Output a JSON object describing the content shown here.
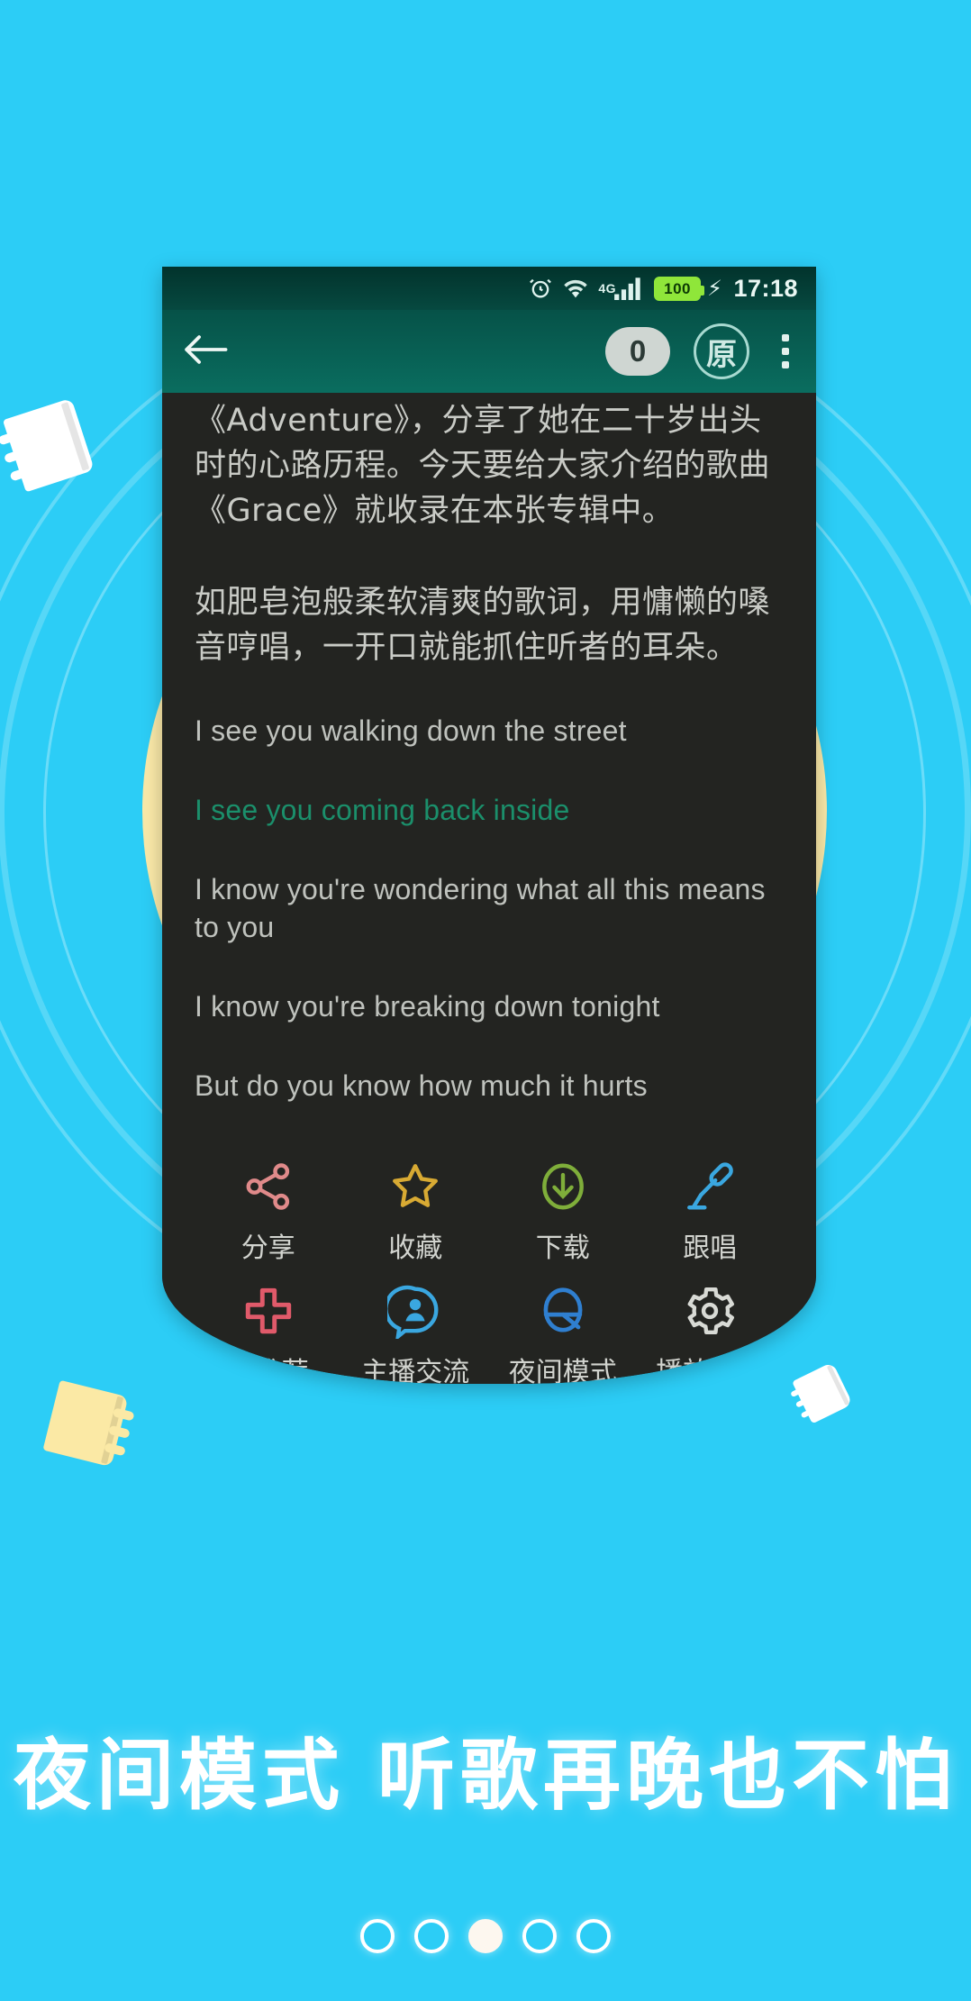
{
  "theme": {
    "background": "#2ccdf6",
    "ring_color": "#ffffff",
    "disc_color": "#fae9a8",
    "header_green": "#0a6d5f",
    "screen_dark": "#232421",
    "active_lyric": "#1b8f6b"
  },
  "phone": {
    "status_bar": {
      "alarm_icon": "alarm-clock-icon",
      "wifi_icon": "wifi-icon",
      "network_label": "4G",
      "signal_icon": "signal-bars-icon",
      "battery_level": "100",
      "charging_icon": "lightning-bolt-icon",
      "time": "17:18"
    },
    "toolbar": {
      "back_icon": "back-arrow-icon",
      "count_badge": "0",
      "original_label": "原",
      "overflow_icon": "kebab-menu-icon"
    },
    "article": {
      "paragraphs": [
        "《Adventure》，分享了她在二十岁出头时的心路历程。今天要给大家介绍的歌曲《Grace》就收录在本张专辑中。",
        "如肥皂泡般柔软清爽的歌词，用慵懒的嗓音哼唱，一开口就能抓住听者的耳朵。"
      ],
      "lyrics": [
        {
          "text": "I see you walking down the street",
          "active": false
        },
        {
          "text": "I see you coming back inside",
          "active": true
        },
        {
          "text": "I know you're wondering what all this means to you",
          "active": false
        },
        {
          "text": "I know you're breaking down tonight",
          "active": false
        },
        {
          "text": "But do you know how much it hurts",
          "active": false
        }
      ]
    },
    "actions": [
      {
        "label": "分享",
        "icon": "share-icon",
        "color": "#e08a8a"
      },
      {
        "label": "收藏",
        "icon": "star-icon",
        "color": "#d8aa33"
      },
      {
        "label": "下载",
        "icon": "download-icon",
        "color": "#7fae3a"
      },
      {
        "label": "跟唱",
        "icon": "microphone-icon",
        "color": "#3aa7e0"
      },
      {
        "label": "来推荐",
        "icon": "plus-icon",
        "color": "#e05a6a"
      },
      {
        "label": "主播交流",
        "icon": "host-chat-icon",
        "color": "#3aa7e0"
      },
      {
        "label": "夜间模式",
        "icon": "night-mode-icon",
        "color": "#2f7fd0"
      },
      {
        "label": "播放设置",
        "icon": "gear-icon",
        "color": "#d8dad5"
      }
    ]
  },
  "headline": "夜间模式  听歌再晚也不怕",
  "pager": {
    "total": 5,
    "current": 3
  }
}
